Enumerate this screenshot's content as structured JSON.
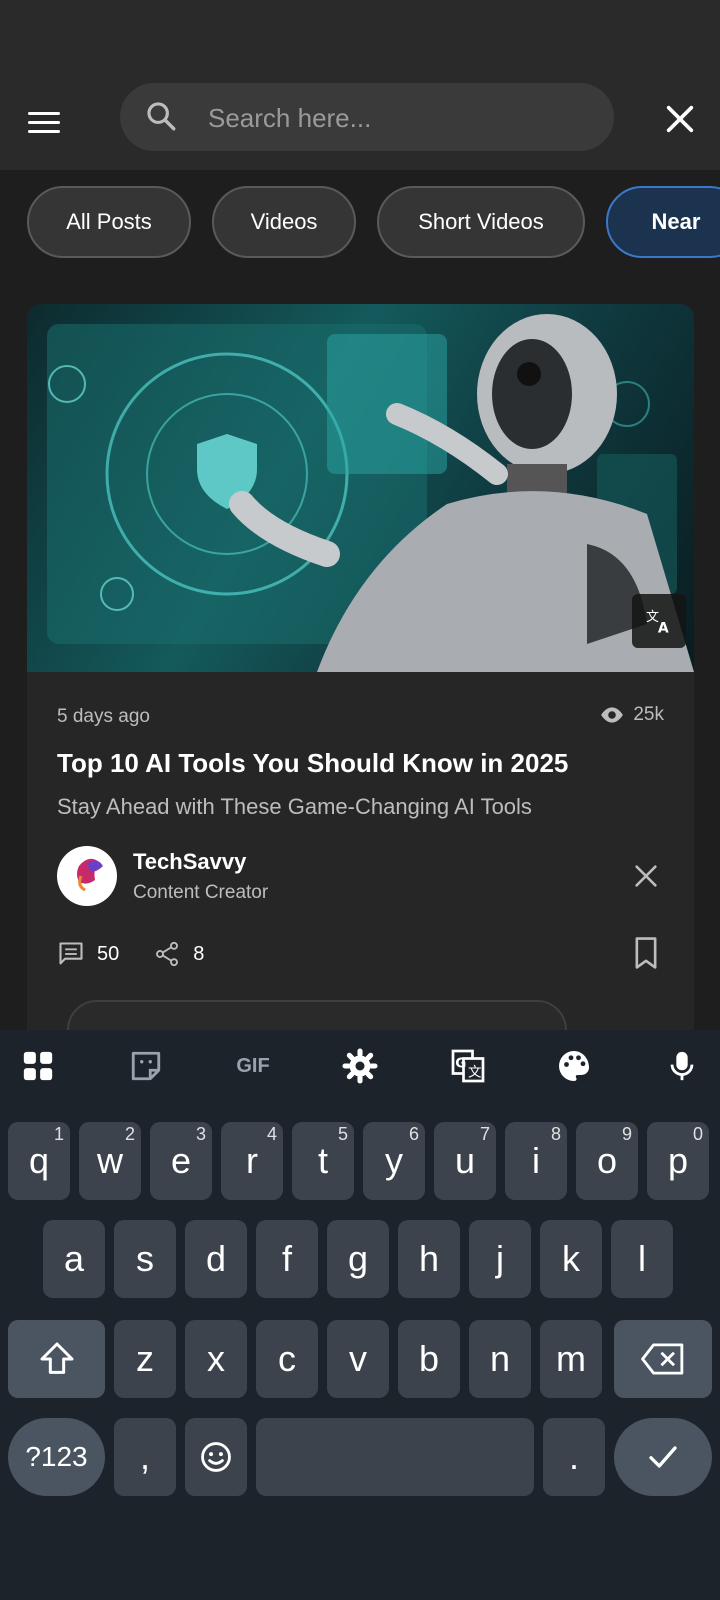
{
  "search": {
    "placeholder": "Search here..."
  },
  "filters": [
    {
      "label": "All Posts",
      "active": false
    },
    {
      "label": "Videos",
      "active": false
    },
    {
      "label": "Short Videos",
      "active": false
    },
    {
      "label": "Near",
      "active": true
    }
  ],
  "post": {
    "time": "5 days ago",
    "views": "25k",
    "title": "Top 10 AI Tools You Should Know in 2025",
    "subtitle": "Stay Ahead with These Game-Changing AI Tools",
    "author": {
      "name": "TechSavvy",
      "role": "Content Creator"
    },
    "comments": "50",
    "shares": "8"
  },
  "keyboard": {
    "tools": [
      "apps-icon",
      "sticker-icon",
      "GIF",
      "settings-icon",
      "translate-icon",
      "palette-icon",
      "mic-icon"
    ],
    "row1": [
      {
        "k": "q",
        "h": "1"
      },
      {
        "k": "w",
        "h": "2"
      },
      {
        "k": "e",
        "h": "3"
      },
      {
        "k": "r",
        "h": "4"
      },
      {
        "k": "t",
        "h": "5"
      },
      {
        "k": "y",
        "h": "6"
      },
      {
        "k": "u",
        "h": "7"
      },
      {
        "k": "i",
        "h": "8"
      },
      {
        "k": "o",
        "h": "9"
      },
      {
        "k": "p",
        "h": "0"
      }
    ],
    "row2": [
      "a",
      "s",
      "d",
      "f",
      "g",
      "h",
      "j",
      "k",
      "l"
    ],
    "row3": [
      "z",
      "x",
      "c",
      "v",
      "b",
      "n",
      "m"
    ],
    "symbols_label": "?123",
    "comma": ",",
    "period": "."
  },
  "colors": {
    "background": "#1e1e1e",
    "accent": "#3a78c8",
    "keyboard": "#1d232a"
  }
}
